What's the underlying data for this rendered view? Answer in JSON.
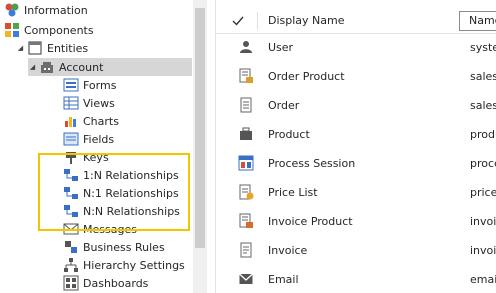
{
  "tree": {
    "items": [
      {
        "label": "Information",
        "icon": "information-icon"
      },
      {
        "label": "Components",
        "icon": "components-icon"
      },
      {
        "label": "Entities",
        "icon": "entities-icon"
      },
      {
        "label": "Account",
        "icon": "account-entity-icon"
      },
      {
        "label": "Forms",
        "icon": "forms-icon"
      },
      {
        "label": "Views",
        "icon": "views-icon"
      },
      {
        "label": "Charts",
        "icon": "charts-icon"
      },
      {
        "label": "Fields",
        "icon": "fields-icon"
      },
      {
        "label": "Keys",
        "icon": "keys-icon"
      },
      {
        "label": "1:N Relationships",
        "icon": "relationship-icon"
      },
      {
        "label": "N:1 Relationships",
        "icon": "relationship-icon"
      },
      {
        "label": "N:N Relationships",
        "icon": "relationship-icon"
      },
      {
        "label": "Messages",
        "icon": "messages-icon"
      },
      {
        "label": "Business Rules",
        "icon": "business-rules-icon"
      },
      {
        "label": "Hierarchy Settings",
        "icon": "hierarchy-icon"
      },
      {
        "label": "Dashboards",
        "icon": "dashboards-icon"
      }
    ]
  },
  "grid": {
    "header": {
      "display_name": "Display Name",
      "col2": "Name"
    },
    "rows": [
      {
        "display_name": "User",
        "col2": "syster",
        "icon": "user-icon"
      },
      {
        "display_name": "Order Product",
        "col2": "salesc",
        "icon": "order-product-icon"
      },
      {
        "display_name": "Order",
        "col2": "salesc",
        "icon": "order-icon"
      },
      {
        "display_name": "Product",
        "col2": "produ",
        "icon": "product-icon"
      },
      {
        "display_name": "Process Session",
        "col2": "proce",
        "icon": "process-session-icon"
      },
      {
        "display_name": "Price List",
        "col2": "pricel",
        "icon": "price-list-icon"
      },
      {
        "display_name": "Invoice Product",
        "col2": "invoic",
        "icon": "invoice-product-icon"
      },
      {
        "display_name": "Invoice",
        "col2": "invoic",
        "icon": "invoice-icon"
      },
      {
        "display_name": "Email",
        "col2": "email",
        "icon": "email-icon"
      }
    ]
  },
  "colors": {
    "highlight": "#f5c400",
    "selected_row": "#d6d6d6"
  }
}
